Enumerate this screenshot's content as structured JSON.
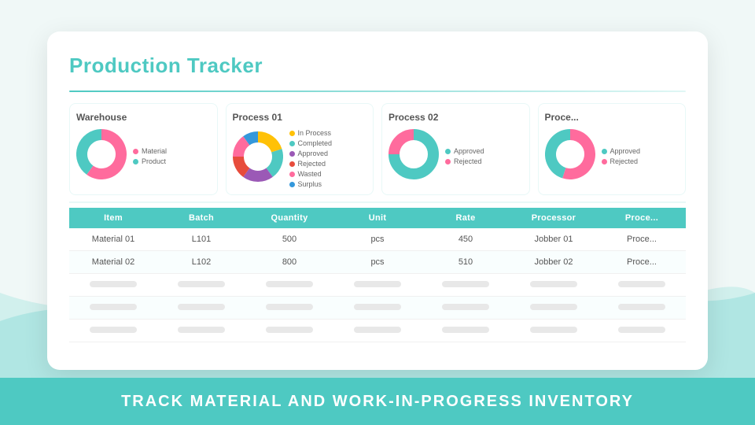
{
  "page": {
    "title": "Production Tracker",
    "background_color": "#e8f6f5"
  },
  "banner": {
    "text": "TRACK MATERIAL AND WORK-IN-PROGRESS INVENTORY",
    "bg_color": "#4ec9c2"
  },
  "charts": [
    {
      "id": "warehouse",
      "title": "Warehouse",
      "legend": [
        {
          "label": "Material",
          "color": "#ff6b9d"
        },
        {
          "label": "Product",
          "color": "#4ec9c2"
        }
      ],
      "segments": [
        {
          "color": "#ff6b9d",
          "pct": 60
        },
        {
          "color": "#4ec9c2",
          "pct": 40
        }
      ]
    },
    {
      "id": "process01",
      "title": "Process 01",
      "legend": [
        {
          "label": "In Process",
          "color": "#ffc107"
        },
        {
          "label": "Completed",
          "color": "#4ec9c2"
        },
        {
          "label": "Approved",
          "color": "#9b59b6"
        },
        {
          "label": "Rejected",
          "color": "#e74c3c"
        },
        {
          "label": "Wasted",
          "color": "#ff6b9d"
        },
        {
          "label": "Surplus",
          "color": "#3498db"
        }
      ],
      "segments": [
        {
          "color": "#ffc107",
          "pct": 20
        },
        {
          "color": "#4ec9c2",
          "pct": 20
        },
        {
          "color": "#9b59b6",
          "pct": 20
        },
        {
          "color": "#e74c3c",
          "pct": 15
        },
        {
          "color": "#ff6b9d",
          "pct": 15
        },
        {
          "color": "#3498db",
          "pct": 10
        }
      ]
    },
    {
      "id": "process02",
      "title": "Process 02",
      "legend": [
        {
          "label": "Approved",
          "color": "#4ec9c2"
        },
        {
          "label": "Rejected",
          "color": "#ff6b9d"
        }
      ],
      "segments": [
        {
          "color": "#4ec9c2",
          "pct": 75
        },
        {
          "color": "#ff6b9d",
          "pct": 25
        }
      ]
    },
    {
      "id": "process03",
      "title": "Proce...",
      "legend": [
        {
          "label": "Approved",
          "color": "#4ec9c2"
        },
        {
          "label": "Rejected",
          "color": "#ff6b9d"
        }
      ],
      "segments": [
        {
          "color": "#ff6b9d",
          "pct": 55
        },
        {
          "color": "#4ec9c2",
          "pct": 45
        }
      ]
    }
  ],
  "table": {
    "headers": [
      "Item",
      "Batch",
      "Quantity",
      "Unit",
      "Rate",
      "Processor",
      "Proce..."
    ],
    "rows": [
      {
        "item": "Material 01",
        "batch": "L101",
        "quantity": "500",
        "unit": "pcs",
        "rate": "450",
        "processor": "Jobber 01",
        "process": "Proce..."
      },
      {
        "item": "Material 02",
        "batch": "L102",
        "quantity": "800",
        "unit": "pcs",
        "rate": "510",
        "processor": "Jobber 02",
        "process": "Proce..."
      }
    ],
    "empty_rows": 3
  }
}
